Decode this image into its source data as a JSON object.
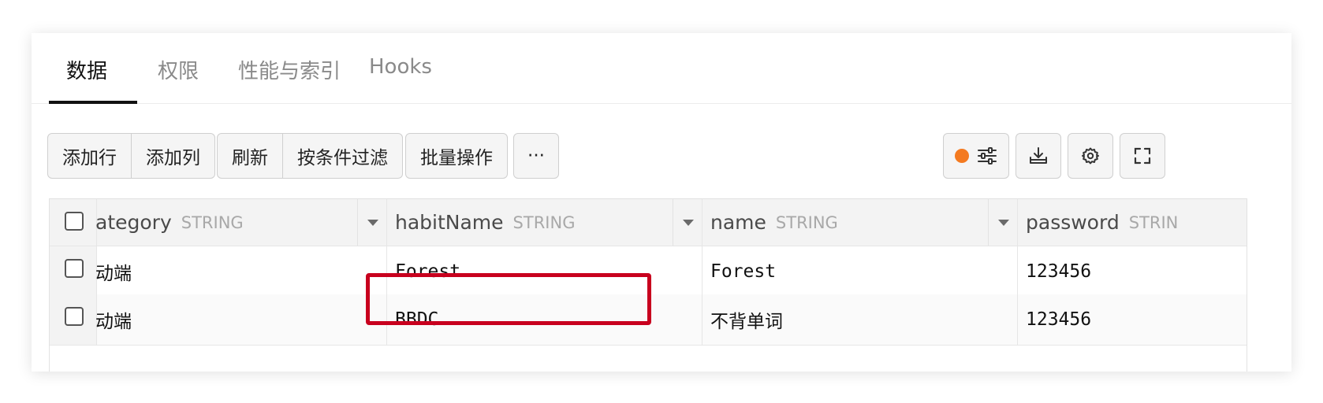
{
  "tabs": [
    {
      "label": "数据",
      "active": true
    },
    {
      "label": "权限",
      "active": false
    },
    {
      "label": "性能与索引",
      "active": false
    },
    {
      "label": "Hooks",
      "active": false
    }
  ],
  "toolbar": {
    "add_row": "添加行",
    "add_column": "添加列",
    "refresh": "刷新",
    "filter": "按条件过滤",
    "batch": "批量操作",
    "more": "···",
    "filter_dot_color": "#f47a20"
  },
  "icons": {
    "settings_toggle": "sliders-icon",
    "export": "download-tray-icon",
    "settings": "gear-icon",
    "fullscreen": "expand-icon"
  },
  "table": {
    "columns": [
      {
        "name": "ategory",
        "type": "STRING"
      },
      {
        "name": "habitName",
        "type": "STRING"
      },
      {
        "name": "name",
        "type": "STRING"
      },
      {
        "name": "password",
        "type": "STRIN"
      }
    ],
    "rows": [
      {
        "category": "动端",
        "habitName": "Forest",
        "name": "Forest",
        "password": "123456"
      },
      {
        "category": "动端",
        "habitName": "BBDC",
        "name": "不背单词",
        "password": "123456"
      }
    ]
  },
  "highlight_color": "#c8001e"
}
